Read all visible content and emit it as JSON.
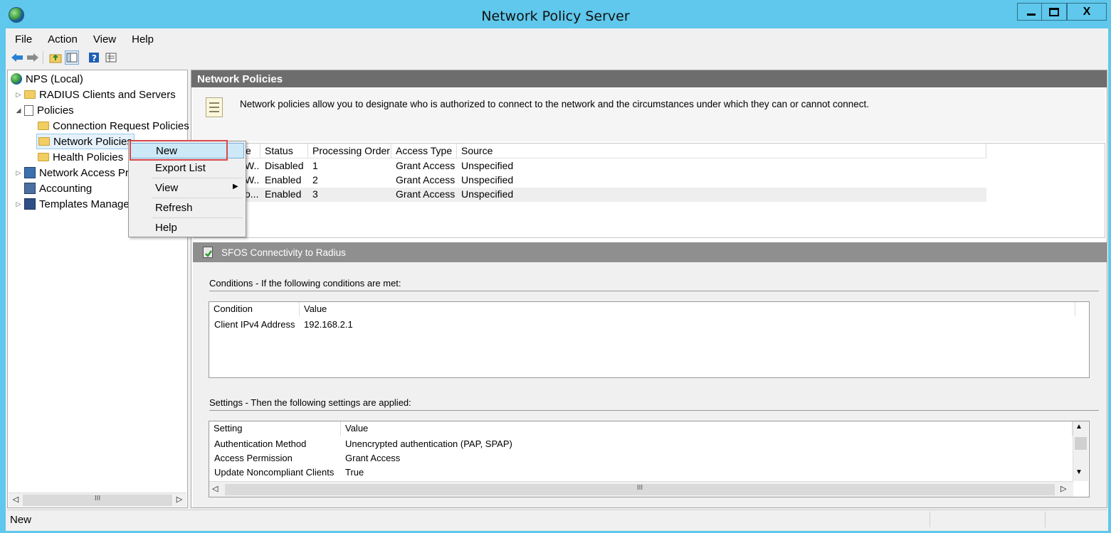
{
  "window": {
    "title": "Network Policy Server",
    "minimize": "—",
    "maximize": "☐",
    "close": "X"
  },
  "menubar": {
    "items": [
      "File",
      "Action",
      "View",
      "Help"
    ]
  },
  "toolbar": {
    "icons": [
      "back-arrow-icon",
      "forward-arrow-icon",
      "up-folder-icon",
      "show-hide-tree-icon",
      "help-icon",
      "properties-icon"
    ]
  },
  "tree": {
    "items": [
      {
        "label": "NPS (Local)"
      },
      {
        "label": "RADIUS Clients and Servers"
      },
      {
        "label": "Policies"
      },
      {
        "label": "Connection Request Policies"
      },
      {
        "label": "Network Policies"
      },
      {
        "label": "Health Policies"
      },
      {
        "label": "Network Access Pro"
      },
      {
        "label": "Accounting"
      },
      {
        "label": "Templates Manage"
      }
    ],
    "scroll_label": "III"
  },
  "right_pane": {
    "header": "Network Policies",
    "description": "Network policies allow you to designate who is authorized to connect to the network and the circumstances under which they can or cannot connect.",
    "policy_table": {
      "columns": [
        "e",
        "Status",
        "Processing Order",
        "Access Type",
        "Source"
      ],
      "rows": [
        {
          "name": "W...",
          "status": "Disabled",
          "order": "1",
          "access": "Grant Access",
          "source": "Unspecified"
        },
        {
          "name": "W...",
          "status": "Enabled",
          "order": "2",
          "access": "Grant Access",
          "source": "Unspecified"
        },
        {
          "name": "o...",
          "status": "Enabled",
          "order": "3",
          "access": "Grant Access",
          "source": "Unspecified"
        }
      ]
    },
    "selected_policy": "SFOS Connectivity to Radius",
    "conditions": {
      "title": "Conditions - If the following conditions are met:",
      "columns": [
        "Condition",
        "Value"
      ],
      "rows": [
        {
          "condition": "Client IPv4 Address",
          "value": "192.168.2.1"
        }
      ]
    },
    "settings": {
      "title": "Settings - Then the following settings are applied:",
      "columns": [
        "Setting",
        "Value"
      ],
      "rows": [
        {
          "setting": "Authentication Method",
          "value": "Unencrypted authentication (PAP, SPAP)"
        },
        {
          "setting": "Access Permission",
          "value": "Grant Access"
        },
        {
          "setting": "Update Noncompliant Clients",
          "value": "True"
        }
      ],
      "scroll_label": "III"
    }
  },
  "context_menu": {
    "items": [
      "New",
      "Export List",
      "View",
      "Refresh",
      "Help"
    ]
  },
  "statusbar": {
    "text": "New"
  }
}
